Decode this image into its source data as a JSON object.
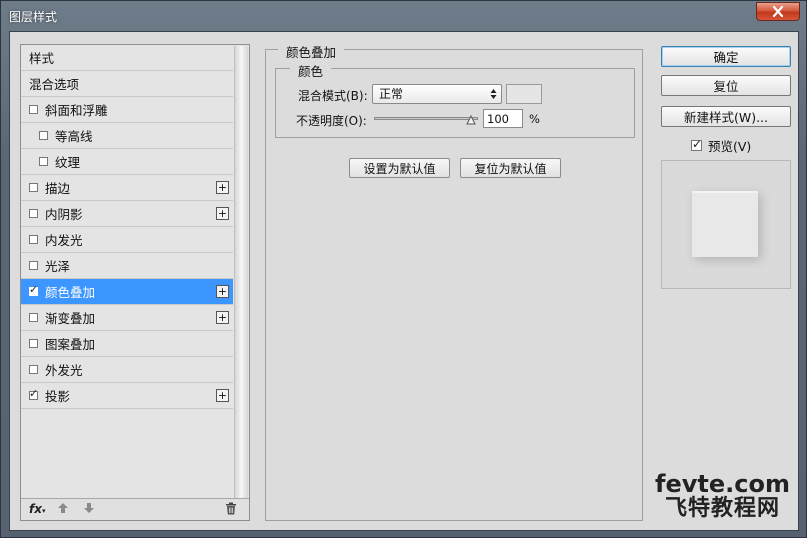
{
  "window": {
    "title": "图层样式",
    "close_icon": "close-icon"
  },
  "sidebar": {
    "items": [
      {
        "label": "样式",
        "has_checkbox": false,
        "checked": false,
        "indent": false,
        "has_plus": false,
        "active": false
      },
      {
        "label": "混合选项",
        "has_checkbox": false,
        "checked": false,
        "indent": false,
        "has_plus": false,
        "active": false
      },
      {
        "label": "斜面和浮雕",
        "has_checkbox": true,
        "checked": false,
        "indent": false,
        "has_plus": false,
        "active": false
      },
      {
        "label": "等高线",
        "has_checkbox": true,
        "checked": false,
        "indent": true,
        "has_plus": false,
        "active": false
      },
      {
        "label": "纹理",
        "has_checkbox": true,
        "checked": false,
        "indent": true,
        "has_plus": false,
        "active": false
      },
      {
        "label": "描边",
        "has_checkbox": true,
        "checked": false,
        "indent": false,
        "has_plus": true,
        "active": false
      },
      {
        "label": "内阴影",
        "has_checkbox": true,
        "checked": false,
        "indent": false,
        "has_plus": true,
        "active": false
      },
      {
        "label": "内发光",
        "has_checkbox": true,
        "checked": false,
        "indent": false,
        "has_plus": false,
        "active": false
      },
      {
        "label": "光泽",
        "has_checkbox": true,
        "checked": false,
        "indent": false,
        "has_plus": false,
        "active": false
      },
      {
        "label": "颜色叠加",
        "has_checkbox": true,
        "checked": true,
        "indent": false,
        "has_plus": true,
        "active": true
      },
      {
        "label": "渐变叠加",
        "has_checkbox": true,
        "checked": false,
        "indent": false,
        "has_plus": true,
        "active": false
      },
      {
        "label": "图案叠加",
        "has_checkbox": true,
        "checked": false,
        "indent": false,
        "has_plus": false,
        "active": false
      },
      {
        "label": "外发光",
        "has_checkbox": true,
        "checked": false,
        "indent": false,
        "has_plus": false,
        "active": false
      },
      {
        "label": "投影",
        "has_checkbox": true,
        "checked": true,
        "indent": false,
        "has_plus": true,
        "active": false
      }
    ],
    "plus_symbol": "+",
    "footer": {
      "fx_label": "fx",
      "up_icon": "arrow-up-icon",
      "down_icon": "arrow-down-icon",
      "trash_icon": "trash-icon"
    }
  },
  "panel": {
    "title": "颜色叠加",
    "group_title": "颜色",
    "blend_mode_label": "混合模式(B):",
    "blend_mode_value": "正常",
    "opacity_label": "不透明度(O):",
    "opacity_value": "100",
    "opacity_unit": "%",
    "opacity_fraction": 1.0,
    "set_default_button": "设置为默认值",
    "reset_default_button": "复位为默认值"
  },
  "actions": {
    "ok_button": "确定",
    "reset_button": "复位",
    "new_style_button": "新建样式(W)...",
    "preview_label": "预览(V)",
    "preview_checked": true
  },
  "watermark": {
    "line1": "fevte.com",
    "line2": "飞特教程网"
  },
  "colors": {
    "active_item": "#3d95ff",
    "dialog_bg": "#dcdcdc",
    "close_button": "#c1381c"
  }
}
